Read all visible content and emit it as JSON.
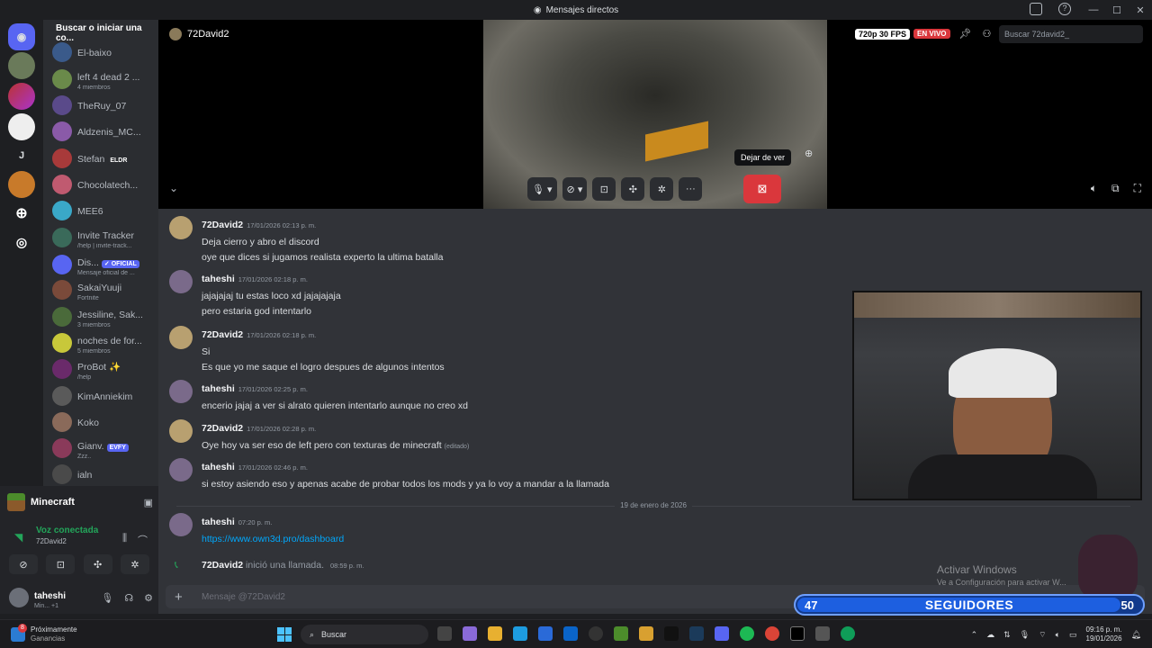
{
  "window": {
    "title": "Mensajes directos"
  },
  "sidebar": {
    "search_label": "Buscar o iniciar una co...",
    "rail_letter": "J",
    "dms": [
      {
        "name": "El-baixo",
        "sub": "",
        "badge": ""
      },
      {
        "name": "left 4 dead 2 ...",
        "sub": "4 miembros",
        "badge": ""
      },
      {
        "name": "TheRuy_07",
        "sub": "",
        "badge": ""
      },
      {
        "name": "Aldzenis_MC...",
        "sub": "",
        "badge": ""
      },
      {
        "name": "Stefan",
        "sub": "",
        "badge": "ELDR"
      },
      {
        "name": "Chocolatech...",
        "sub": "",
        "badge": ""
      },
      {
        "name": "MEE6",
        "sub": "",
        "badge": ""
      },
      {
        "name": "Invite Tracker",
        "sub": "/help | invite-track...",
        "badge": ""
      },
      {
        "name": "Dis...",
        "sub": "Mensaje oficial de ...",
        "badge": "✓ OFICIAL"
      },
      {
        "name": "SakaiYuuji",
        "sub": "Fortnite",
        "badge": ""
      },
      {
        "name": "Jessiline, Sak...",
        "sub": "3 miembros",
        "badge": ""
      },
      {
        "name": "noches de for...",
        "sub": "5 miembros",
        "badge": ""
      },
      {
        "name": "ProBot ✨",
        "sub": "/help",
        "badge": ""
      },
      {
        "name": "KimAnniekim",
        "sub": "",
        "badge": ""
      },
      {
        "name": "Koko",
        "sub": "",
        "badge": ""
      },
      {
        "name": "Gianv.",
        "sub": "Zzz..",
        "badge": "EVFY"
      },
      {
        "name": "ialn",
        "sub": "",
        "badge": ""
      }
    ]
  },
  "voice": {
    "game": "Minecraft",
    "status": "Voz conectada",
    "channel": "72David2"
  },
  "user": {
    "name": "taheshi",
    "status": "Min... +1"
  },
  "stream": {
    "dm_name": "72David2",
    "quality": "720p 30 FPS",
    "live_label": "EN VIVO",
    "search_placeholder": "Buscar 72david2_",
    "tooltip": "Dejar de ver"
  },
  "messages": [
    {
      "author": "72David2",
      "time": "17/01/2026 02:13 p. m.",
      "lines": [
        "Deja cierro y abro el discord",
        "oye que dices si jugamos realista experto la ultima batalla"
      ]
    },
    {
      "author": "taheshi",
      "time": "17/01/2026 02:18 p. m.",
      "lines": [
        "jajajajaj tu estas loco xd jajajajaja",
        "pero estaria god intentarlo"
      ]
    },
    {
      "author": "72David2",
      "time": "17/01/2026 02:18 p. m.",
      "lines": [
        "Si",
        "Es que yo me saque el logro despues de algunos intentos"
      ]
    },
    {
      "author": "taheshi",
      "time": "17/01/2026 02:25 p. m.",
      "lines": [
        "encerio jajaj  a ver si alrato quieren intentarlo aunque  no creo xd"
      ]
    },
    {
      "author": "72David2",
      "time": "17/01/2026 02:28 p. m.",
      "lines": [
        "Oye hoy va ser eso de left pero con texturas de minecraft"
      ],
      "edited": "(editado)"
    },
    {
      "author": "taheshi",
      "time": "17/01/2026 02:46 p. m.",
      "lines": [
        "si estoy asiendo eso y apenas acabe de probar todos los mods y ya lo voy a mandar a la llamada"
      ]
    },
    {
      "author": "taheshi",
      "time": "07:20 p. m.",
      "link": "https://www.own3d.pro/dashboard"
    }
  ],
  "date_separator": "19 de enero de 2026",
  "call_message": {
    "author": "72David2",
    "text": "inició una llamada.",
    "time": "08:59 p. m."
  },
  "composer": {
    "placeholder": "Mensaje @72David2"
  },
  "windows_watermark": {
    "title": "Activar Windows",
    "subtitle": "Ve a Configuración para activar W..."
  },
  "followers_widget": {
    "current": "47",
    "label": "SEGUIDORES",
    "goal": "50",
    "progress": 0.94
  },
  "taskbar": {
    "weather_badge": "8",
    "weather_title": "Próximamente",
    "weather_sub": "Ganancias",
    "search_label": "Buscar",
    "time": "09:16 p. m.",
    "date": "19/01/2026"
  }
}
